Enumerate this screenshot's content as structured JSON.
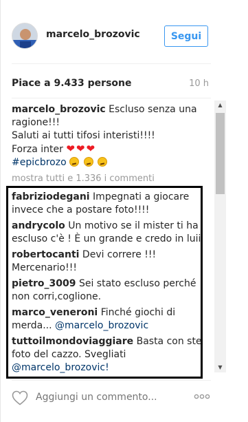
{
  "post": {
    "username": "marcelo_brozovic",
    "follow_label": "Segui",
    "likes_text": "Piace a 9.433 persone",
    "time_text": "10 h"
  },
  "caption": {
    "username": "marcelo_brozovic",
    "line1": "Escluso senza una ragione!!!",
    "line2": "Saluti ai tutti tifosi interisti!!!!",
    "line3": "Forza inter",
    "hearts": "❤❤❤",
    "hashtag": "#epicbrozo",
    "emojis": "😕😕😕"
  },
  "more_comments_label": "mostra tutti e 1.336 i commenti",
  "comments": [
    {
      "user": "fabriziodegani",
      "text": "Impegnati a giocare invece che a postare foto!!!!"
    },
    {
      "user": "andrycolo",
      "text": "Un motivo se il mister ti ha escluso c'è ! È un grande e credo in luii"
    },
    {
      "user": "robertocanti",
      "text": "Devi correre !!! Mercenario!!!"
    },
    {
      "user": "pietro_3009",
      "text": "Sei stato escluso perché non corri,coglione."
    },
    {
      "user": "marco_veneroni",
      "text": "Finché giochi di merda...",
      "mention": "@marcelo_brozovic"
    },
    {
      "user": "tuttoilmondoviaggiare",
      "text": "Basta con ste foto del cazzo. Svegliati",
      "mention": "@marcelo_brozovic!"
    }
  ],
  "footer": {
    "add_comment_placeholder": "Aggiungi un commento...",
    "heart_icon": "heart-icon",
    "more_icon": "more-options-icon"
  },
  "colors": {
    "accent": "#3897f0",
    "link": "#003569",
    "muted": "#999999",
    "highlight_border": "#000000"
  }
}
